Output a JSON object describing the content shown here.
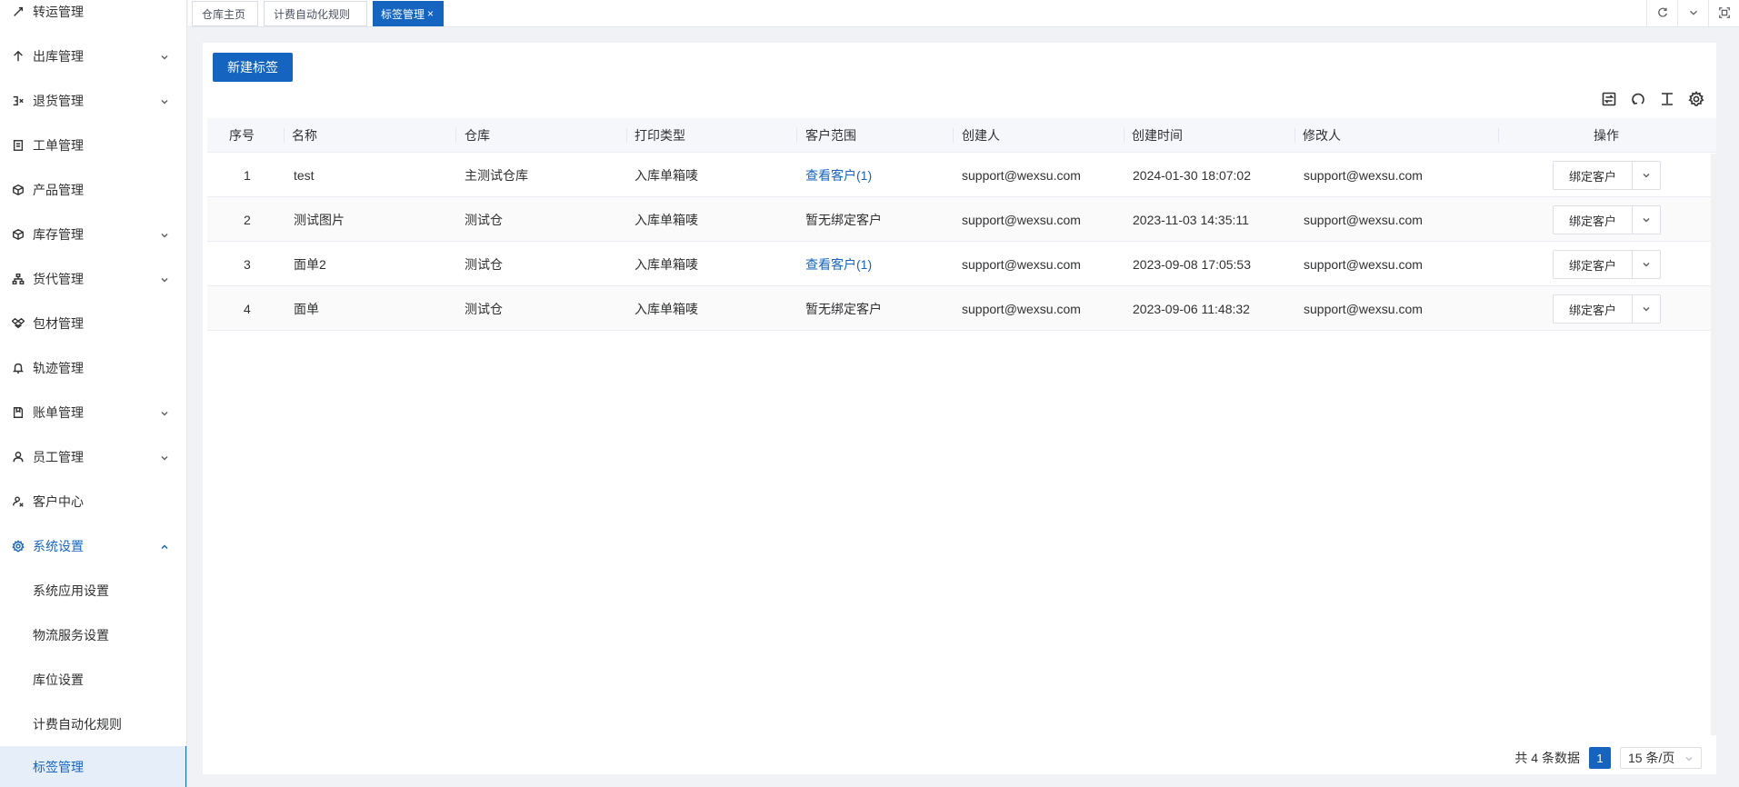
{
  "sidebar": {
    "items": [
      {
        "label": "转运管理",
        "icon": "transfer-icon",
        "has_arrow": false
      },
      {
        "label": "出库管理",
        "icon": "arrow-up-icon",
        "has_arrow": true
      },
      {
        "label": "退货管理",
        "icon": "return-icon",
        "has_arrow": true
      },
      {
        "label": "工单管理",
        "icon": "document-icon",
        "has_arrow": false
      },
      {
        "label": "产品管理",
        "icon": "product-icon",
        "has_arrow": false
      },
      {
        "label": "库存管理",
        "icon": "box-icon",
        "has_arrow": true
      },
      {
        "label": "货代管理",
        "icon": "network-icon",
        "has_arrow": true
      },
      {
        "label": "包材管理",
        "icon": "package-icon",
        "has_arrow": false
      },
      {
        "label": "轨迹管理",
        "icon": "bell-icon",
        "has_arrow": false
      },
      {
        "label": "账单管理",
        "icon": "bill-icon",
        "has_arrow": true
      },
      {
        "label": "员工管理",
        "icon": "user-icon",
        "has_arrow": true
      },
      {
        "label": "客户中心",
        "icon": "customer-icon",
        "has_arrow": false
      },
      {
        "label": "系统设置",
        "icon": "gear-icon",
        "has_arrow": true,
        "expanded": true
      }
    ],
    "subitems": [
      {
        "label": "系统应用设置"
      },
      {
        "label": "物流服务设置"
      },
      {
        "label": "库位设置"
      },
      {
        "label": "计费自动化规则"
      },
      {
        "label": "标签管理",
        "active": true
      }
    ]
  },
  "tabs": [
    {
      "label": "仓库主页"
    },
    {
      "label": "计费自动化规则"
    },
    {
      "label": "标签管理",
      "active": true,
      "close": "×"
    }
  ],
  "toolbar": {
    "new_label": "新建标签"
  },
  "table": {
    "headers": [
      "序号",
      "名称",
      "仓库",
      "打印类型",
      "客户范围",
      "创建人",
      "创建时间",
      "修改人",
      "操作"
    ],
    "rows": [
      {
        "index": "1",
        "name": "test",
        "warehouse": "主测试仓库",
        "print_type": "入库单箱唛",
        "scope": "查看客户(1)",
        "scope_link": true,
        "creator": "support@wexsu.com",
        "created": "2024-01-30 18:07:02",
        "modifier": "support@wexsu.com",
        "action": "绑定客户"
      },
      {
        "index": "2",
        "name": "测试图片",
        "warehouse": "测试仓",
        "print_type": "入库单箱唛",
        "scope": "暂无绑定客户",
        "scope_link": false,
        "creator": "support@wexsu.com",
        "created": "2023-11-03 14:35:11",
        "modifier": "support@wexsu.com",
        "action": "绑定客户"
      },
      {
        "index": "3",
        "name": "面单2",
        "warehouse": "测试仓",
        "print_type": "入库单箱唛",
        "scope": "查看客户(1)",
        "scope_link": true,
        "creator": "support@wexsu.com",
        "created": "2023-09-08 17:05:53",
        "modifier": "support@wexsu.com",
        "action": "绑定客户"
      },
      {
        "index": "4",
        "name": "面单",
        "warehouse": "测试仓",
        "print_type": "入库单箱唛",
        "scope": "暂无绑定客户",
        "scope_link": false,
        "creator": "support@wexsu.com",
        "created": "2023-09-06 11:48:32",
        "modifier": "support@wexsu.com",
        "action": "绑定客户"
      }
    ]
  },
  "pagination": {
    "total_text": "共 4 条数据",
    "current_page": "1",
    "page_size": "15 条/页"
  },
  "colors": {
    "accent": "#1565c0"
  }
}
